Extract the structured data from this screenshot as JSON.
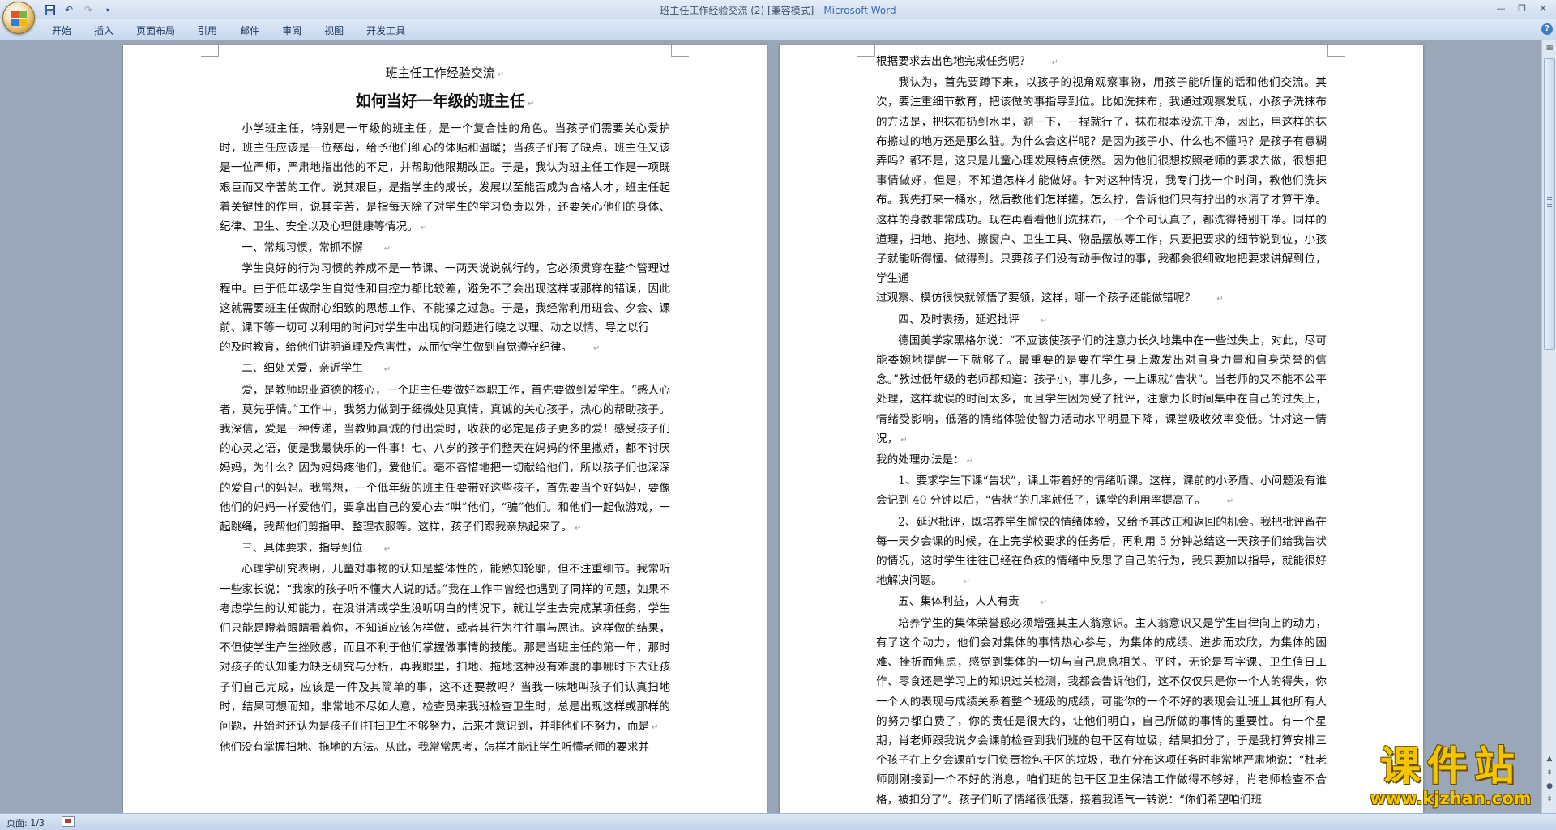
{
  "window": {
    "title": "班主任工作经验交流 (2) [兼容模式] - ",
    "app_name": "Microsoft Word",
    "controls": [
      "—",
      "❐",
      "✕"
    ]
  },
  "ribbon": {
    "tabs": [
      "开始",
      "插入",
      "页面布局",
      "引用",
      "邮件",
      "审阅",
      "视图",
      "开发工具"
    ],
    "help": "?"
  },
  "quick_access": [
    "save-icon",
    "undo-icon",
    "redo-icon",
    "customize-icon"
  ],
  "left_page": {
    "subtitle": "班主任工作经验交流",
    "title": "如何当好一年级的班主任",
    "paragraphs": [
      "小学班主任，特别是一年级的班主任，是一个复合性的角色。当孩子们需要关心爱护时，班主任应该是一位慈母，给予他们细心的体贴和温暖；当孩子们有了缺点，班主任又该是一位严师，严肃地指出他的不足，并帮助他限期改正。于是，我认为班主任工作是一项既艰巨而又辛苦的工作。说其艰巨，是指学生的成长，发展以至能否成为合格人才，班主任起着关键性的作用，说其辛苦，是指每天除了对学生的学习负责以外，还要关心他们的身体、纪律、卫生、安全以及心理健康等情况。",
      "一、常规习惯，常抓不懈",
      "学生良好的行为习惯的养成不是一节课、一两天说说就行的，它必须贯穿在整个管理过程中。由于低年级学生自觉性和自控力都比较差，避免不了会出现这样或那样的错误，因此这就需要班主任做耐心细致的思想工作、不能操之过急。于是，我经常利用班会、夕会、课前、课下等一切可以利用的时间对学生中出现的问题进行晓之以理、动之以情、导之以行",
      "的及时教育，给他们讲明道理及危害性，从而使学生做到自觉遵守纪律。",
      "二、细处关爱，亲近学生",
      "爱，是教师职业道德的核心，一个班主任要做好本职工作，首先要做到爱学生。“感人心者，莫先乎情。”工作中，我努力做到于细微处见真情，真诚的关心孩子，热心的帮助孩子。我深信，爱是一种传递，当教师真诚的付出爱时，收获的必定是孩子更多的爱！感受孩子们的心灵之语，便是我最快乐的一件事！七、八岁的孩子们整天在妈妈的怀里撒娇，都不讨厌妈妈，为什么？因为妈妈疼他们，爱他们。毫不吝惜地把一切献给他们，所以孩子们也深深的爱自己的妈妈。我常想，一个低年级的班主任要带好这些孩子，首先要当个好妈妈，要像他们的妈妈一样爱他们，要拿出自己的爱心去“哄”他们，“骗”他们。和他们一起做游戏，一起跳绳，我帮他们剪指甲、整理衣服等。这样，孩子们跟我亲热起来了。",
      "三、具体要求，指导到位",
      "心理学研究表明，儿童对事物的认知是整体性的，能熟知轮廓，但不注重细节。我常听一些家长说：“我家的孩子听不懂大人说的话。”我在工作中曾经也遇到了同样的问题，如果不考虑学生的认知能力，在没讲清或学生没听明白的情况下，就让学生去完成某项任务，学生们只能是瞪着眼睛看着你，不知道应该怎样做，或者其行为往往事与愿违。这样做的结果，不但使学生产生挫败感，而且不利于他们掌握做事情的技能。那是当班主任的第一年，那时对孩子的认知能力缺乏研究与分析，再我眼里，扫地、拖地这种没有难度的事哪时下去让孩子们自己完成，应该是一件及其简单的事，这不还要教吗？当我一味地叫孩子们认真扫地时，结果可想而知，非常地不尽如人意，检查员来我班检查卫生时，总是出现这样或那样的问题，开始时还认为是孩子们打扫卫生不够努力，后来才意识到，并非他们不努力，而是",
      "他们没有掌握扫地、拖地的方法。从此，我常常思考，怎样才能让学生听懂老师的要求并"
    ]
  },
  "right_page": {
    "paragraphs": [
      "根据要求去出色地完成任务呢？",
      "我认为，首先要蹲下来，以孩子的视角观察事物，用孩子能听懂的话和他们交流。其次，要注重细节教育，把该做的事指导到位。比如洗抹布，我通过观察发现，小孩子洗抹布的方法是，把抹布扔到水里，涮一下，一捏就行了，抹布根本没洗干净，因此，用这样的抹布擦过的地方还是那么脏。为什么会这样呢？是因为孩子小、什么也不懂吗？是孩子有意糊弄吗？都不是，这只是儿童心理发展特点使然。因为他们很想按照老师的要求去做，很想把事情做好，但是，不知道怎样才能做好。针对这种情况，我专门找一个时间，教他们洗抹布。我先打来一桶水，然后教他们怎样搓，怎么拧，告诉他们只有拧出的水清了才算干净。这样的身教非常成功。现在再看看他们洗抹布，一个个可认真了，都洗得特别干净。同样的道理，扫地、拖地、擦窗户、卫生工具、物品摆放等工作，只要把要求的细节说到位，小孩子就能听得懂、做得到。只要孩子们没有动手做过的事，我都会很细致地把要求讲解到位，学生通",
      "过观察、模仿很快就领悟了要领，这样，哪一个孩子还能做错呢？",
      "四、及时表扬，延迟批评",
      "德国美学家黑格尔说：“不应该使孩子们的注意力长久地集中在一些过失上，对此，尽可能委婉地提醒一下就够了。最重要的是要在学生身上激发出对自身力量和自身荣誉的信念。”教过低年级的老师都知道：孩子小，事儿多，一上课就“告状”。当老师的又不能不公平处理，这样耽误的时间太多，而且学生因为受了批评，注意力长时间集中在自己的过失上，情绪受影响，低落的情绪体验使智力活动水平明显下降，课堂吸收效率变低。针对这一情况，",
      "我的处理办法是：",
      "1、要求学生下课“告状”，课上带着好的情绪听课。这样，课前的小矛盾、小问题没有谁会记到 40 分钟以后，“告状”的几率就低了，课堂的利用率提高了。",
      "2、延迟批评，既培养学生愉快的情绪体验，又给予其改正和返回的机会。我把批评留在每一天夕会课的时候，在上完学校要求的任务后，再利用 5 分钟总结这一天孩子们给我告状的情况，这时学生往往已经在负疚的情绪中反思了自己的行为，我只要加以指导，就能很好地解决问题。",
      "五、集体利益，人人有责",
      "培养学生的集体荣誉感必须增强其主人翁意识。主人翁意识又是学生自律向上的动力，有了这个动力，他们会对集体的事情热心参与，为集体的成绩、进步而欢欣，为集体的困难、挫折而焦虑，感觉到集体的一切与自己息息相关。平时，无论是写字课、卫生值日工作、零食还是学习上的知识过关检测，我都会告诉他们，这不仅仅只是你一个人的得失，你一个人的表现与成绩关系着整个班级的成绩，可能你的一个不好的表现会让班上其他所有人的努力都白费了，你的责任是很大的，让他们明白，自己所做的事情的重要性。有一个星期，肖老师跟我说夕会课前检查到我们班的包干区有垃圾，结果扣分了，于是我打算安排三个孩子在上夕会课前专门负责捡包干区的垃圾，我在分布这项任务时非常地严肃地说：“杜老师刚刚接到一个不好的消息，咱们班的包干区卫生保洁工作做得不够好，肖老师检查不合格，被扣分了”。孩子们听了情绪很低落，接着我语气一转说：“你们希望咱们班"
    ]
  },
  "status": {
    "page": "页面: 1/3"
  },
  "watermark": {
    "text": "课件站",
    "url": "www.kjzhan.com"
  }
}
